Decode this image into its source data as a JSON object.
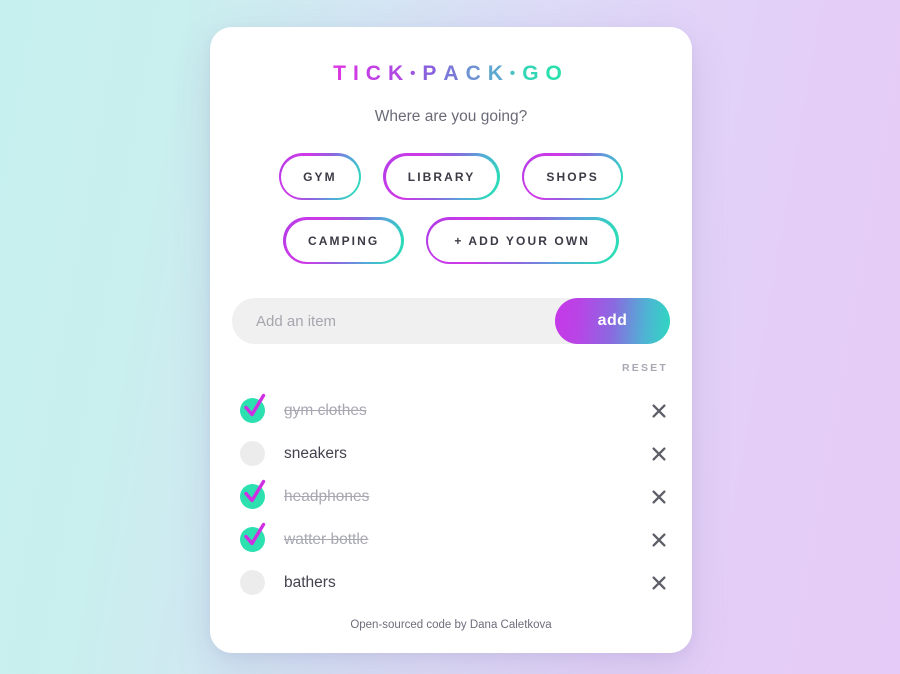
{
  "background": {
    "gradient_from": "#c6f0ef",
    "gradient_to": "#e5cbf7"
  },
  "brand": {
    "text": "TICK • PACK • GO",
    "letters": [
      {
        "ch": "T",
        "color": "#d937e2"
      },
      {
        "ch": "I",
        "color": "#cf3ae4"
      },
      {
        "ch": "C",
        "color": "#c23fe5"
      },
      {
        "ch": "K",
        "color": "#b048e3"
      },
      {
        "ch": "•",
        "color": "#9a55e0"
      },
      {
        "ch": "P",
        "color": "#8a61dd"
      },
      {
        "ch": "A",
        "color": "#7b79d8"
      },
      {
        "ch": "C",
        "color": "#6f92d2"
      },
      {
        "ch": "K",
        "color": "#5fa8cf"
      },
      {
        "ch": "•",
        "color": "#4cc0c6"
      },
      {
        "ch": "G",
        "color": "#35d6b6"
      },
      {
        "ch": "O",
        "color": "#2ce0ae"
      }
    ],
    "gradient_start": "#d937e2",
    "gradient_mid": "#7b79d8",
    "gradient_end": "#2ce0ae"
  },
  "tagline": "Where are you going?",
  "categories": {
    "row1": [
      {
        "label": "GYM"
      },
      {
        "label": "LIBRARY"
      },
      {
        "label": "SHOPS"
      }
    ],
    "row2": [
      {
        "label": "CAMPING"
      },
      {
        "label": "+ ADD YOUR OWN"
      }
    ]
  },
  "add_form": {
    "placeholder": "Add an item",
    "value": "",
    "button_label": "add",
    "button_gradient_start": "#c638e8",
    "button_gradient_end": "#2ed8c0"
  },
  "reset": {
    "label": "RESET"
  },
  "items": [
    {
      "label": "gym clothes",
      "done": true,
      "delete_icon": "close-icon"
    },
    {
      "label": "sneakers",
      "done": false,
      "delete_icon": "close-icon"
    },
    {
      "label": "headphones",
      "done": true,
      "delete_icon": "close-icon"
    },
    {
      "label": "watter bottle",
      "done": true,
      "delete_icon": "close-icon"
    },
    {
      "label": "bathers",
      "done": false,
      "delete_icon": "close-icon"
    }
  ],
  "checkbox": {
    "checked_circle_color": "#2ce0b0",
    "unchecked_circle_color": "#ececec",
    "tick_color": "#cf2fe2"
  },
  "footer": {
    "text": "Open-sourced code by Dana Caletkova"
  }
}
